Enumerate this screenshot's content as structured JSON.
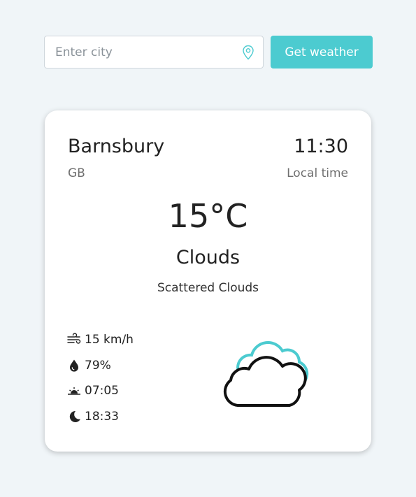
{
  "search": {
    "placeholder": "Enter city",
    "button_label": "Get weather",
    "location_icon": "map-pin-icon"
  },
  "weather": {
    "city": "Barnsbury",
    "country": "GB",
    "time": "11:30",
    "time_label": "Local time",
    "temperature": "15°C",
    "condition": "Clouds",
    "description": "Scattered Clouds",
    "stats": {
      "wind": "15 km/h",
      "humidity": "79%",
      "sunrise": "07:05",
      "sunset": "18:33"
    },
    "icon": "clouds-icon"
  },
  "colors": {
    "accent": "#4ccbd0",
    "background": "#f0f5f8",
    "card": "#ffffff",
    "text": "#222222",
    "muted": "#6f6f6f"
  }
}
